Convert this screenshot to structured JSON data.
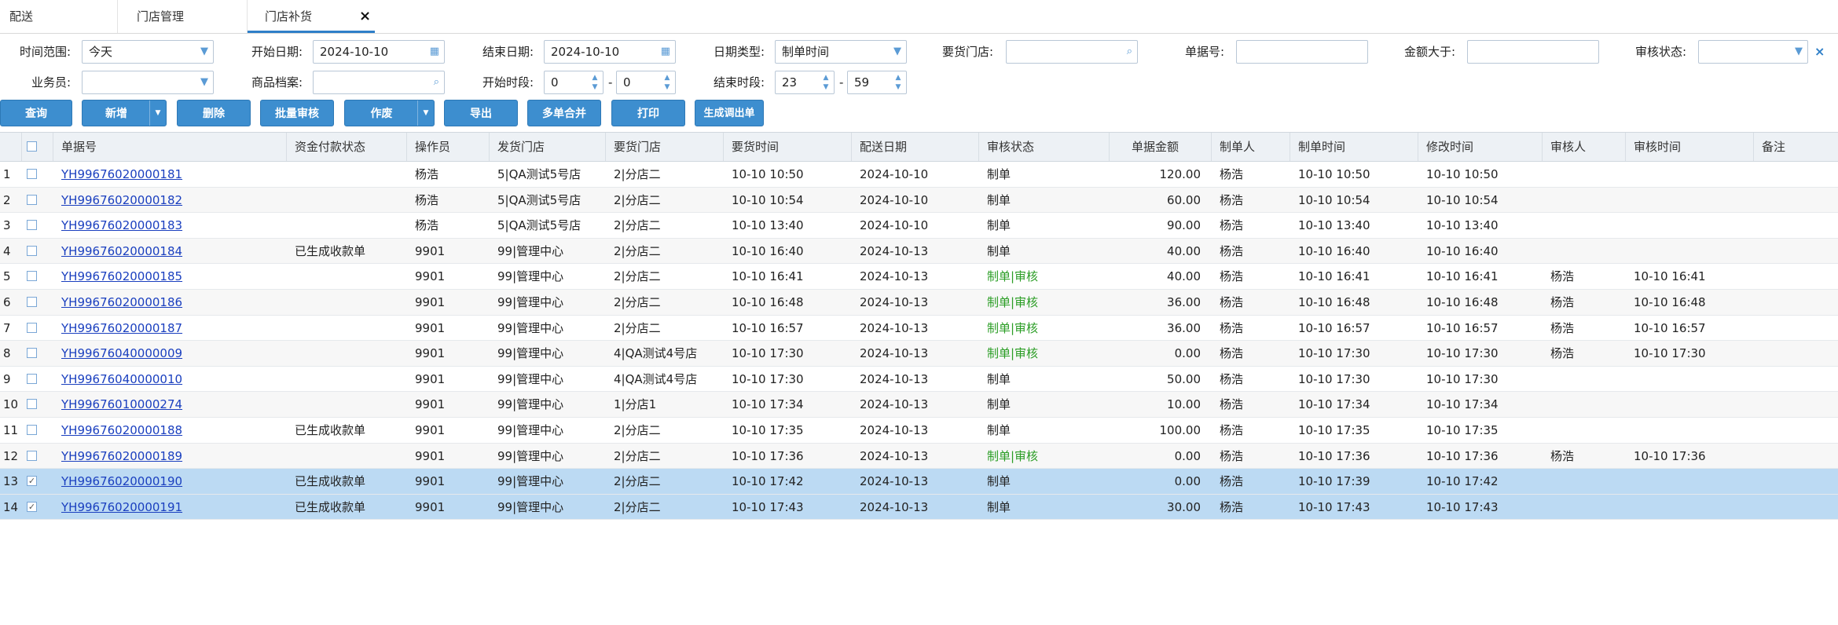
{
  "tabs": [
    {
      "label": "配送"
    },
    {
      "label": "门店管理"
    },
    {
      "label": "门店补货",
      "active": true
    }
  ],
  "tab_close_symbol": "×",
  "filters": {
    "time_range": {
      "label": "时间范围:",
      "value": "今天"
    },
    "start_date": {
      "label": "开始日期:",
      "value": "2024-10-10"
    },
    "end_date": {
      "label": "结束日期:",
      "value": "2024-10-10"
    },
    "date_type": {
      "label": "日期类型:",
      "value": "制单时间"
    },
    "request_store": {
      "label": "要货门店:",
      "value": ""
    },
    "doc_no": {
      "label": "单据号:",
      "value": ""
    },
    "amount_gt": {
      "label": "金额大于:",
      "value": ""
    },
    "audit_status": {
      "label": "审核状态:",
      "value": ""
    },
    "salesman": {
      "label": "业务员:",
      "value": ""
    },
    "product": {
      "label": "商品档案:",
      "value": ""
    },
    "start_period": {
      "label": "开始时段:",
      "from": "0",
      "to": "0"
    },
    "end_period": {
      "label": "结束时段:",
      "from": "23",
      "to": "59"
    },
    "range_sep": "-"
  },
  "toolbar": {
    "query": "查询",
    "new": "新增",
    "delete": "删除",
    "batch_audit": "批量审核",
    "void": "作废",
    "export": "导出",
    "merge": "多单合并",
    "print": "打印",
    "gen_transfer": "生成调出单"
  },
  "columns": {
    "doc_no": "单据号",
    "pay_status": "资金付款状态",
    "operator": "操作员",
    "ship_store": "发货门店",
    "request_store": "要货门店",
    "request_time": "要货时间",
    "delivery_date": "配送日期",
    "audit_status": "审核状态",
    "amount": "单据金额",
    "creator": "制单人",
    "create_time": "制单时间",
    "modify_time": "修改时间",
    "auditor": "审核人",
    "audit_time": "审核时间",
    "remark": "备注"
  },
  "rows": [
    {
      "no": "1",
      "checked": false,
      "doc": "YH99676020000181",
      "pay": "",
      "op": "杨浩",
      "ship": "5|QA测试5号店",
      "req": "2|分店二",
      "rtime": "10-10 10:50",
      "ddate": "2024-10-10",
      "status": "制单",
      "approved": false,
      "amt": "120.00",
      "creator": "杨浩",
      "ctime": "10-10 10:50",
      "mtime": "10-10 10:50",
      "auditor": "",
      "atime": ""
    },
    {
      "no": "2",
      "checked": false,
      "doc": "YH99676020000182",
      "pay": "",
      "op": "杨浩",
      "ship": "5|QA测试5号店",
      "req": "2|分店二",
      "rtime": "10-10 10:54",
      "ddate": "2024-10-10",
      "status": "制单",
      "approved": false,
      "amt": "60.00",
      "creator": "杨浩",
      "ctime": "10-10 10:54",
      "mtime": "10-10 10:54",
      "auditor": "",
      "atime": ""
    },
    {
      "no": "3",
      "checked": false,
      "doc": "YH99676020000183",
      "pay": "",
      "op": "杨浩",
      "ship": "5|QA测试5号店",
      "req": "2|分店二",
      "rtime": "10-10 13:40",
      "ddate": "2024-10-10",
      "status": "制单",
      "approved": false,
      "amt": "90.00",
      "creator": "杨浩",
      "ctime": "10-10 13:40",
      "mtime": "10-10 13:40",
      "auditor": "",
      "atime": ""
    },
    {
      "no": "4",
      "checked": false,
      "doc": "YH99676020000184",
      "pay": "已生成收款单",
      "op": "9901",
      "ship": "99|管理中心",
      "req": "2|分店二",
      "rtime": "10-10 16:40",
      "ddate": "2024-10-13",
      "status": "制单",
      "approved": false,
      "amt": "40.00",
      "creator": "杨浩",
      "ctime": "10-10 16:40",
      "mtime": "10-10 16:40",
      "auditor": "",
      "atime": ""
    },
    {
      "no": "5",
      "checked": false,
      "doc": "YH99676020000185",
      "pay": "",
      "op": "9901",
      "ship": "99|管理中心",
      "req": "2|分店二",
      "rtime": "10-10 16:41",
      "ddate": "2024-10-13",
      "status": "制单|审核",
      "approved": true,
      "amt": "40.00",
      "creator": "杨浩",
      "ctime": "10-10 16:41",
      "mtime": "10-10 16:41",
      "auditor": "杨浩",
      "atime": "10-10 16:41"
    },
    {
      "no": "6",
      "checked": false,
      "doc": "YH99676020000186",
      "pay": "",
      "op": "9901",
      "ship": "99|管理中心",
      "req": "2|分店二",
      "rtime": "10-10 16:48",
      "ddate": "2024-10-13",
      "status": "制单|审核",
      "approved": true,
      "amt": "36.00",
      "creator": "杨浩",
      "ctime": "10-10 16:48",
      "mtime": "10-10 16:48",
      "auditor": "杨浩",
      "atime": "10-10 16:48"
    },
    {
      "no": "7",
      "checked": false,
      "doc": "YH99676020000187",
      "pay": "",
      "op": "9901",
      "ship": "99|管理中心",
      "req": "2|分店二",
      "rtime": "10-10 16:57",
      "ddate": "2024-10-13",
      "status": "制单|审核",
      "approved": true,
      "amt": "36.00",
      "creator": "杨浩",
      "ctime": "10-10 16:57",
      "mtime": "10-10 16:57",
      "auditor": "杨浩",
      "atime": "10-10 16:57"
    },
    {
      "no": "8",
      "checked": false,
      "doc": "YH99676040000009",
      "pay": "",
      "op": "9901",
      "ship": "99|管理中心",
      "req": "4|QA测试4号店",
      "rtime": "10-10 17:30",
      "ddate": "2024-10-13",
      "status": "制单|审核",
      "approved": true,
      "amt": "0.00",
      "creator": "杨浩",
      "ctime": "10-10 17:30",
      "mtime": "10-10 17:30",
      "auditor": "杨浩",
      "atime": "10-10 17:30"
    },
    {
      "no": "9",
      "checked": false,
      "doc": "YH99676040000010",
      "pay": "",
      "op": "9901",
      "ship": "99|管理中心",
      "req": "4|QA测试4号店",
      "rtime": "10-10 17:30",
      "ddate": "2024-10-13",
      "status": "制单",
      "approved": false,
      "amt": "50.00",
      "creator": "杨浩",
      "ctime": "10-10 17:30",
      "mtime": "10-10 17:30",
      "auditor": "",
      "atime": ""
    },
    {
      "no": "10",
      "checked": false,
      "doc": "YH99676010000274",
      "pay": "",
      "op": "9901",
      "ship": "99|管理中心",
      "req": "1|分店1",
      "rtime": "10-10 17:34",
      "ddate": "2024-10-13",
      "status": "制单",
      "approved": false,
      "amt": "10.00",
      "creator": "杨浩",
      "ctime": "10-10 17:34",
      "mtime": "10-10 17:34",
      "auditor": "",
      "atime": ""
    },
    {
      "no": "11",
      "checked": false,
      "doc": "YH99676020000188",
      "pay": "已生成收款单",
      "op": "9901",
      "ship": "99|管理中心",
      "req": "2|分店二",
      "rtime": "10-10 17:35",
      "ddate": "2024-10-13",
      "status": "制单",
      "approved": false,
      "amt": "100.00",
      "creator": "杨浩",
      "ctime": "10-10 17:35",
      "mtime": "10-10 17:35",
      "auditor": "",
      "atime": ""
    },
    {
      "no": "12",
      "checked": false,
      "doc": "YH99676020000189",
      "pay": "",
      "op": "9901",
      "ship": "99|管理中心",
      "req": "2|分店二",
      "rtime": "10-10 17:36",
      "ddate": "2024-10-13",
      "status": "制单|审核",
      "approved": true,
      "amt": "0.00",
      "creator": "杨浩",
      "ctime": "10-10 17:36",
      "mtime": "10-10 17:36",
      "auditor": "杨浩",
      "atime": "10-10 17:36"
    },
    {
      "no": "13",
      "checked": true,
      "doc": "YH99676020000190",
      "pay": "已生成收款单",
      "op": "9901",
      "ship": "99|管理中心",
      "req": "2|分店二",
      "rtime": "10-10 17:42",
      "ddate": "2024-10-13",
      "status": "制单",
      "approved": false,
      "amt": "0.00",
      "creator": "杨浩",
      "ctime": "10-10 17:39",
      "mtime": "10-10 17:42",
      "auditor": "",
      "atime": ""
    },
    {
      "no": "14",
      "checked": true,
      "doc": "YH99676020000191",
      "pay": "已生成收款单",
      "op": "9901",
      "ship": "99|管理中心",
      "req": "2|分店二",
      "rtime": "10-10 17:43",
      "ddate": "2024-10-13",
      "status": "制单",
      "approved": false,
      "amt": "30.00",
      "creator": "杨浩",
      "ctime": "10-10 17:43",
      "mtime": "10-10 17:43",
      "auditor": "",
      "atime": ""
    }
  ],
  "colors": {
    "accent": "#3d8ecf",
    "link": "#1a3fbf",
    "approved": "#2a9d24",
    "selected_row": "#bcdaf3"
  }
}
